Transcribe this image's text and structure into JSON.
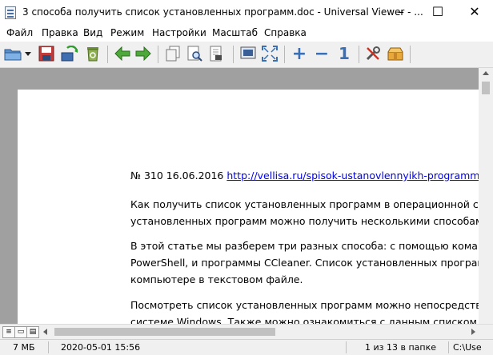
{
  "window": {
    "title": "3 способа получить список установленных программ.doc - Universal Viewer - ...",
    "minimize": "–",
    "maximize": "☐",
    "close": "✕"
  },
  "menu": [
    "Файл",
    "Правка",
    "Вид",
    "Режим",
    "Настройки",
    "Масштаб",
    "Справка"
  ],
  "toolbar": {
    "icons": [
      "open-folder-icon",
      "dropdown-arrow-icon",
      "save-icon",
      "reload-icon",
      "recycle-bin-icon",
      "back-arrow-icon",
      "forward-arrow-icon",
      "copy-icon",
      "print-preview-icon",
      "print-icon",
      "export-icon",
      "screen-icon",
      "fit-window-icon",
      "zoom-in-icon",
      "zoom-out-icon",
      "actual-size-icon",
      "settings-icon",
      "package-icon"
    ],
    "zoom_in": "+",
    "zoom_out": "−",
    "actual_size": "1"
  },
  "document": {
    "line1_prefix": "№ 310 16.06.2016 ",
    "line1_link": "http://vellisa.ru/spisok-ustanovlennyikh-programm",
    "para1_line1": "Как получить список установленных программ в операционной системе W",
    "para1_line2": "установленных программ можно получить несколькими способами.",
    "para2_line1": "В этой статье мы разберем три разных способа: с помощью командной с",
    "para2_line2": "PowerShell, и программы CCleaner. Список установленных программ буд",
    "para2_line3": "компьютере в текстовом файле.",
    "para3_line1": "Посмотреть список установленных программ можно непосредственно в",
    "para3_line2": "системе Windows. Также можно ознакомиться с данным списком устано"
  },
  "view_modes": [
    "≡",
    "▭",
    "▤"
  ],
  "status": {
    "size": "7 МБ",
    "date": "2020-05-01 15:56",
    "position": "1 из 13 в папке",
    "path": "C:\\Use"
  },
  "colors": {
    "toolbar_bg": "#f0f0f0",
    "doc_bg": "#a0a0a0",
    "link": "#0000ee"
  }
}
